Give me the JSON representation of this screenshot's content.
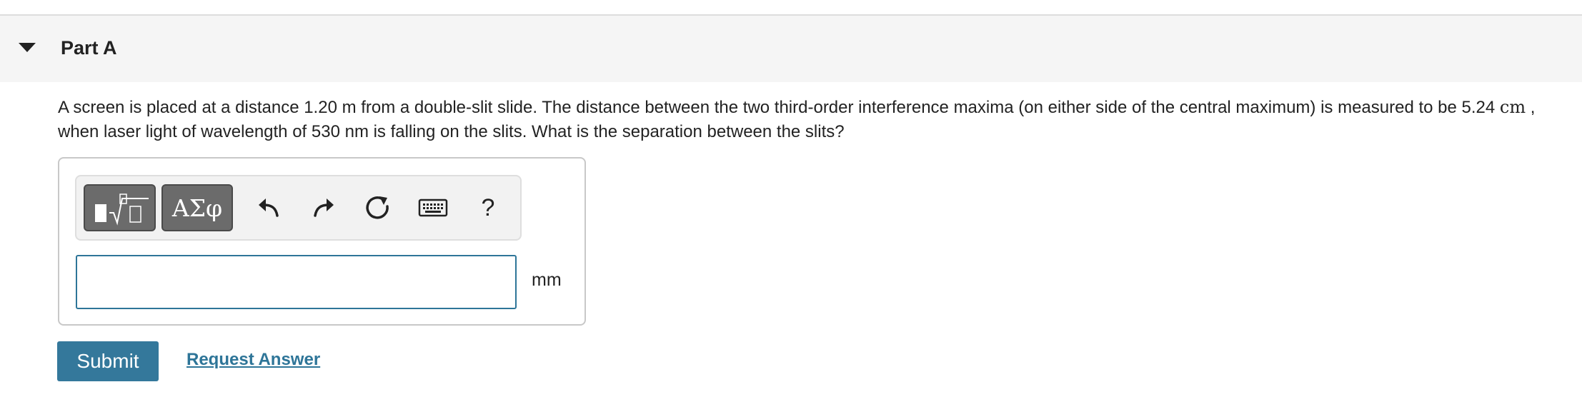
{
  "part": {
    "title": "Part A",
    "expanded": true
  },
  "question": {
    "text_before_value": "A screen is placed at a distance 1.20 m from a double-slit slide. The distance between the two third-order interference maxima (on either side of the central maximum) is measured to be 5.24",
    "value_unit": "cm",
    "text_after_value": ", when laser light of wavelength of 530 nm is falling on the slits. What is the separation between the slits?"
  },
  "toolbar": {
    "template_button_icon": "templates-icon",
    "greek_button_label": "ΑΣφ",
    "undo_icon": "undo-icon",
    "redo_icon": "redo-icon",
    "reset_icon": "reset-icon",
    "keyboard_icon": "keyboard-icon",
    "help_label": "?"
  },
  "answer": {
    "value": "",
    "placeholder": "",
    "unit": "mm"
  },
  "actions": {
    "submit_label": "Submit",
    "request_answer_label": "Request Answer"
  },
  "colors": {
    "accent": "#34789b",
    "link": "#2e7598",
    "header_bg": "#f5f5f5",
    "toolbar_button": "#6b6b6b"
  }
}
